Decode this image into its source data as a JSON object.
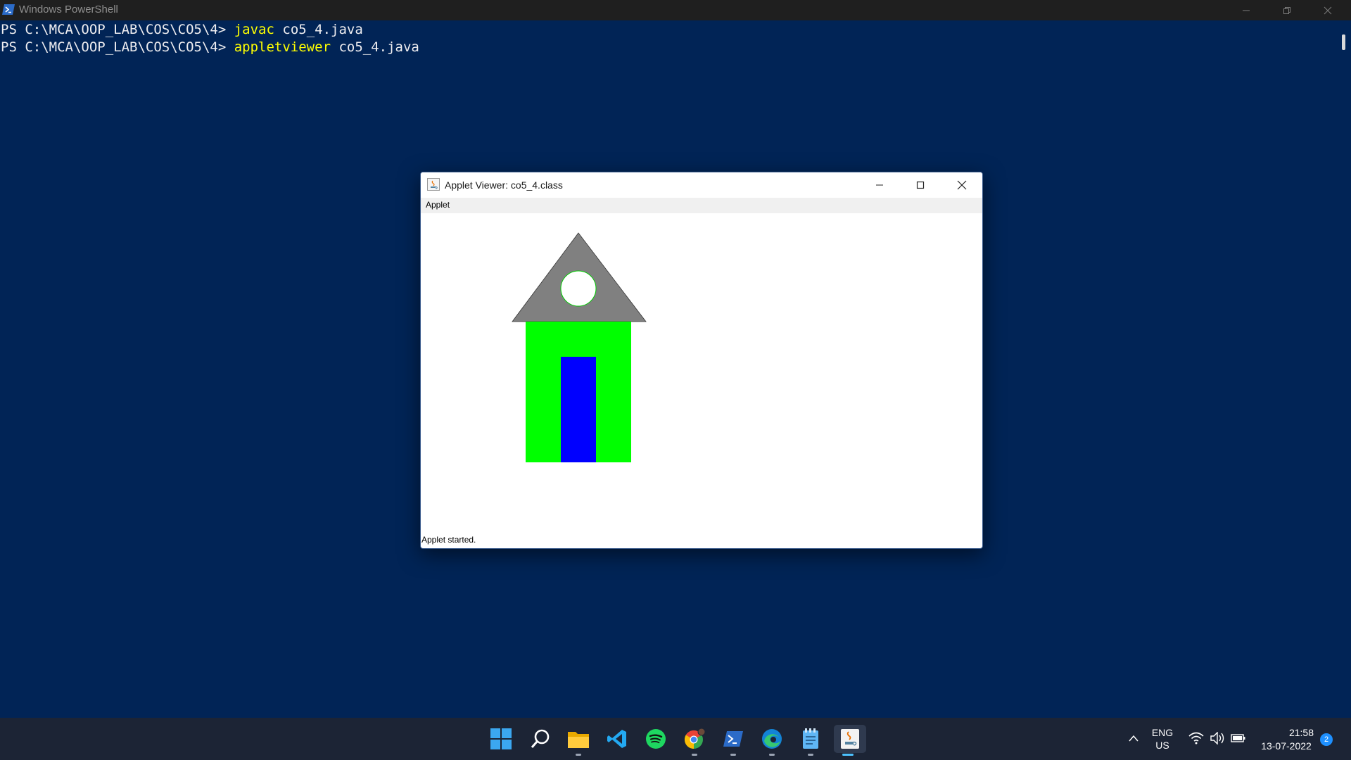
{
  "powershell": {
    "title": "Windows PowerShell",
    "lines": [
      {
        "prompt": "PS C:\\MCA\\OOP_LAB\\COS\\CO5\\4> ",
        "command": "javac",
        "args": " co5_4.java"
      },
      {
        "prompt": "PS C:\\MCA\\OOP_LAB\\COS\\CO5\\4> ",
        "command": "appletviewer",
        "args": " co5_4.java"
      }
    ],
    "colors": {
      "background": "#012456",
      "text": "#eeedf0",
      "command": "#ffff00"
    }
  },
  "applet_viewer": {
    "title": "Applet Viewer: co5_4.class",
    "menu": [
      "Applet"
    ],
    "status": "Applet started.",
    "drawing": {
      "roof_color": "#808080",
      "body_color": "#00ff00",
      "door_color": "#0000ff",
      "window_color": "#ffffff"
    }
  },
  "taskbar": {
    "apps": [
      {
        "name": "start-icon"
      },
      {
        "name": "search-icon"
      },
      {
        "name": "file-explorer-icon"
      },
      {
        "name": "vscode-icon"
      },
      {
        "name": "spotify-icon"
      },
      {
        "name": "chrome-icon"
      },
      {
        "name": "powershell-icon"
      },
      {
        "name": "edge-icon"
      },
      {
        "name": "notepad-icon"
      },
      {
        "name": "java-icon"
      }
    ],
    "language": {
      "line1": "ENG",
      "line2": "US"
    },
    "clock": {
      "time": "21:58",
      "date": "13-07-2022"
    },
    "notification_count": "2"
  }
}
